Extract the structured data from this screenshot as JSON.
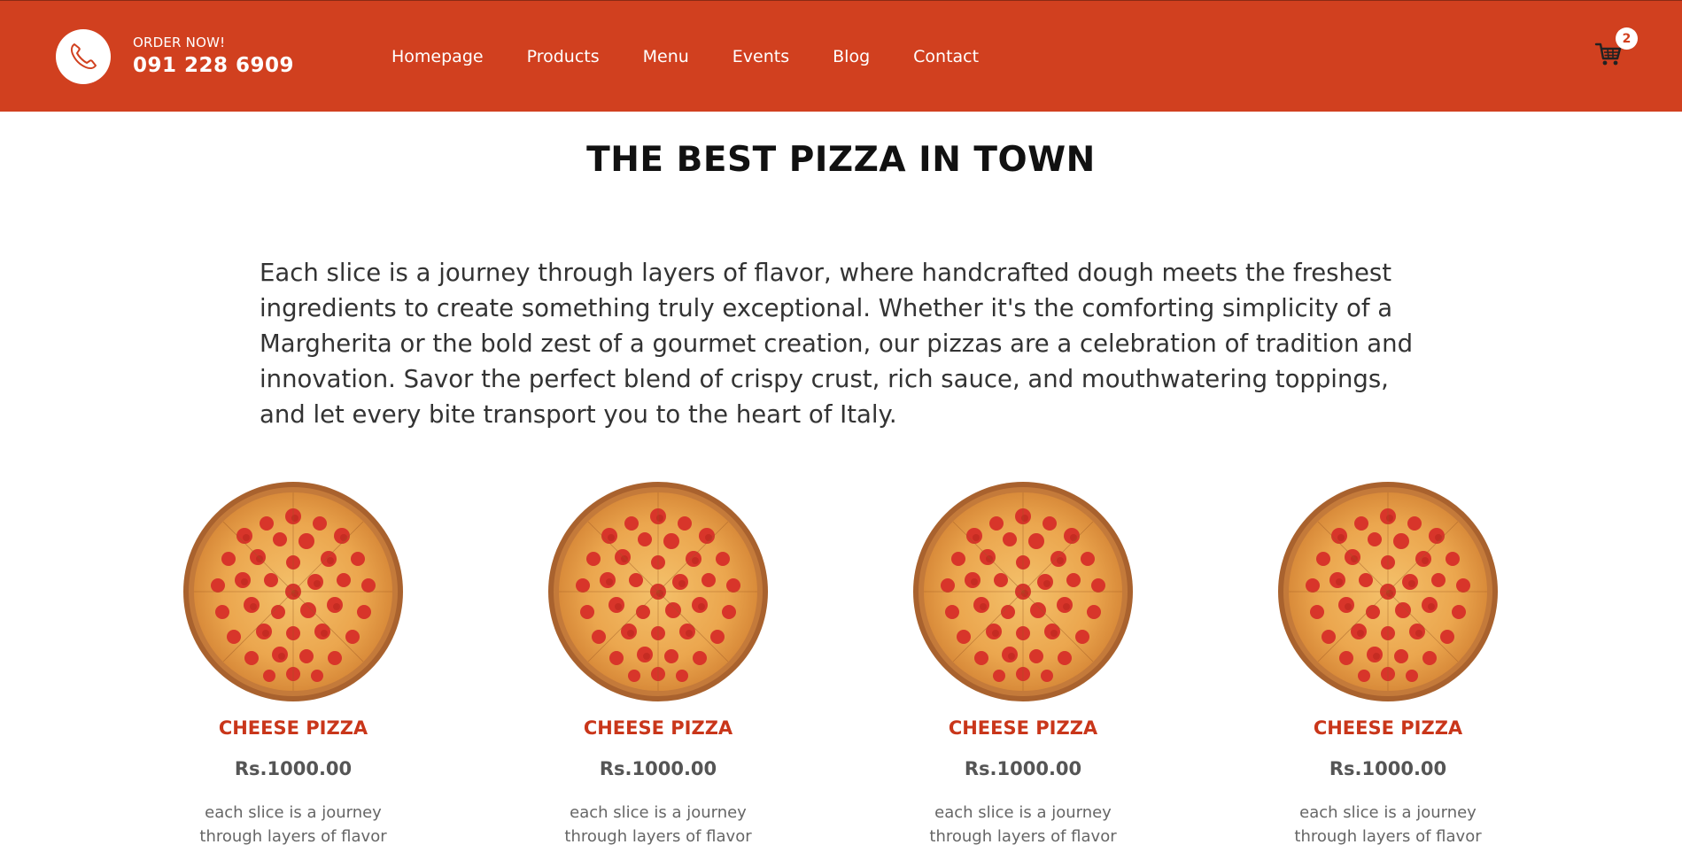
{
  "header": {
    "order_label": "ORDER NOW!",
    "phone_number": "091 228 6909",
    "nav_items": [
      "Homepage",
      "Products",
      "Menu",
      "Events",
      "Blog",
      "Contact"
    ],
    "cart_count": "2",
    "background_color": "#d1401f"
  },
  "hero": {
    "title": "THE BEST PIZZA IN TOWN",
    "description": "Each slice is a journey through layers of flavor, where handcrafted dough meets the freshest ingredients to create something truly exceptional. Whether it's the comforting simplicity of a Margherita or the bold zest of a gourmet creation, our pizzas are a celebration of tradition and innovation. Savor the perfect blend of crispy crust, rich sauce, and mouthwatering toppings, and let every bite transport you to the heart of Italy."
  },
  "products": [
    {
      "name": "CHEESE PIZZA",
      "price": "Rs.1000.00",
      "description": "each slice is a journey through layers of flavor"
    },
    {
      "name": "CHEESE PIZZA",
      "price": "Rs.1000.00",
      "description": "each slice is a journey through layers of flavor"
    },
    {
      "name": "CHEESE PIZZA",
      "price": "Rs.1000.00",
      "description": "each slice is a journey through layers of flavor"
    },
    {
      "name": "CHEESE PIZZA",
      "price": "Rs.1000.00",
      "description": "each slice is a journey through layers of flavor"
    }
  ],
  "icons": {
    "phone": "phone-icon",
    "cart": "cart-icon",
    "product_image": "pepperoni-pizza-image"
  }
}
